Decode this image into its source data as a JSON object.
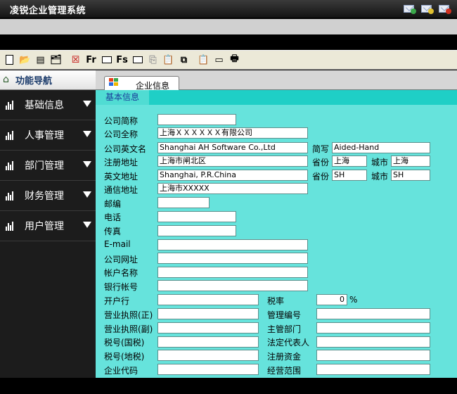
{
  "app": {
    "title": "凌锐企业管理系统"
  },
  "titlebar_icons": [
    {
      "name": "mail-add-icon",
      "dot": "#3aa84a"
    },
    {
      "name": "mail-minimize-icon",
      "dot": "#e0c030"
    },
    {
      "name": "mail-close-icon",
      "dot": "#d03020"
    }
  ],
  "toolbar": {
    "buttons": [
      {
        "name": "new-icon",
        "glyph": ""
      },
      {
        "name": "open-folder-icon",
        "glyph": "📂"
      },
      {
        "name": "document-list-icon",
        "glyph": "▤"
      },
      {
        "name": "export-icon",
        "glyph": "🗂"
      },
      {
        "name": "delete-icon",
        "glyph": "☒"
      },
      {
        "name": "fr-icon",
        "glyph": "Fr"
      },
      {
        "name": "frame-icon",
        "glyph": "▭"
      },
      {
        "name": "fs-icon",
        "glyph": "Fs"
      },
      {
        "name": "field-icon",
        "glyph": "▭"
      },
      {
        "name": "copy-disabled-icon",
        "glyph": "⎘"
      },
      {
        "name": "paste-icon",
        "glyph": "📋"
      },
      {
        "name": "duplicate-icon",
        "glyph": "⧉"
      },
      {
        "name": "clipboard-icon",
        "glyph": "📋"
      },
      {
        "name": "card-icon",
        "glyph": "▭"
      },
      {
        "name": "print-icon",
        "glyph": "🖶"
      }
    ]
  },
  "sidebar": {
    "header": "功能导航",
    "items": [
      {
        "label": "基础信息"
      },
      {
        "label": "人事管理"
      },
      {
        "label": "部门管理"
      },
      {
        "label": "财务管理"
      },
      {
        "label": "用户管理"
      }
    ]
  },
  "tabs": [
    {
      "label": "企业信息"
    }
  ],
  "subtab": "基本信息",
  "form": {
    "company_short": {
      "label": "公司简称",
      "value": ""
    },
    "company_full": {
      "label": "公司全称",
      "value": "上海ＸＸＸＸＸＸ有限公司"
    },
    "company_en": {
      "label": "公司英文名",
      "value": "Shanghai AH Software Co.,Ltd"
    },
    "abbr": {
      "label": "简写",
      "value": "Aided-Hand"
    },
    "reg_addr": {
      "label": "注册地址",
      "value": "上海市闸北区"
    },
    "province1": {
      "label": "省份",
      "value": "上海"
    },
    "city1": {
      "label": "城市",
      "value": "上海"
    },
    "en_addr": {
      "label": "英文地址",
      "value": "Shanghai, P.R.China"
    },
    "province2": {
      "label": "省份",
      "value": "SH"
    },
    "city2": {
      "label": "城市",
      "value": "SH"
    },
    "mail_addr": {
      "label": "通信地址",
      "value": "上海市XXXXX"
    },
    "postcode": {
      "label": "邮编",
      "value": ""
    },
    "phone": {
      "label": "电话",
      "value": ""
    },
    "fax": {
      "label": "传真",
      "value": ""
    },
    "email": {
      "label": "E-mail",
      "value": ""
    },
    "website": {
      "label": "公司网址",
      "value": ""
    },
    "account_name": {
      "label": "帐户名称",
      "value": ""
    },
    "bank_account": {
      "label": "银行帐号",
      "value": ""
    },
    "bank": {
      "label": "开户行",
      "value": ""
    },
    "tax_rate": {
      "label": "税率",
      "value": "0",
      "unit": "%"
    },
    "license_main": {
      "label": "营业执照(正)",
      "value": ""
    },
    "mgmt_no": {
      "label": "管理编号",
      "value": ""
    },
    "license_copy": {
      "label": "营业执照(副)",
      "value": ""
    },
    "dept_in_charge": {
      "label": "主管部门",
      "value": ""
    },
    "tax_national": {
      "label": "税号(国税)",
      "value": ""
    },
    "legal_rep": {
      "label": "法定代表人",
      "value": ""
    },
    "tax_local": {
      "label": "税号(地税)",
      "value": ""
    },
    "reg_capital": {
      "label": "注册资金",
      "value": ""
    },
    "org_code": {
      "label": "企业代码",
      "value": ""
    },
    "business_scope": {
      "label": "经营范围",
      "value": ""
    }
  }
}
